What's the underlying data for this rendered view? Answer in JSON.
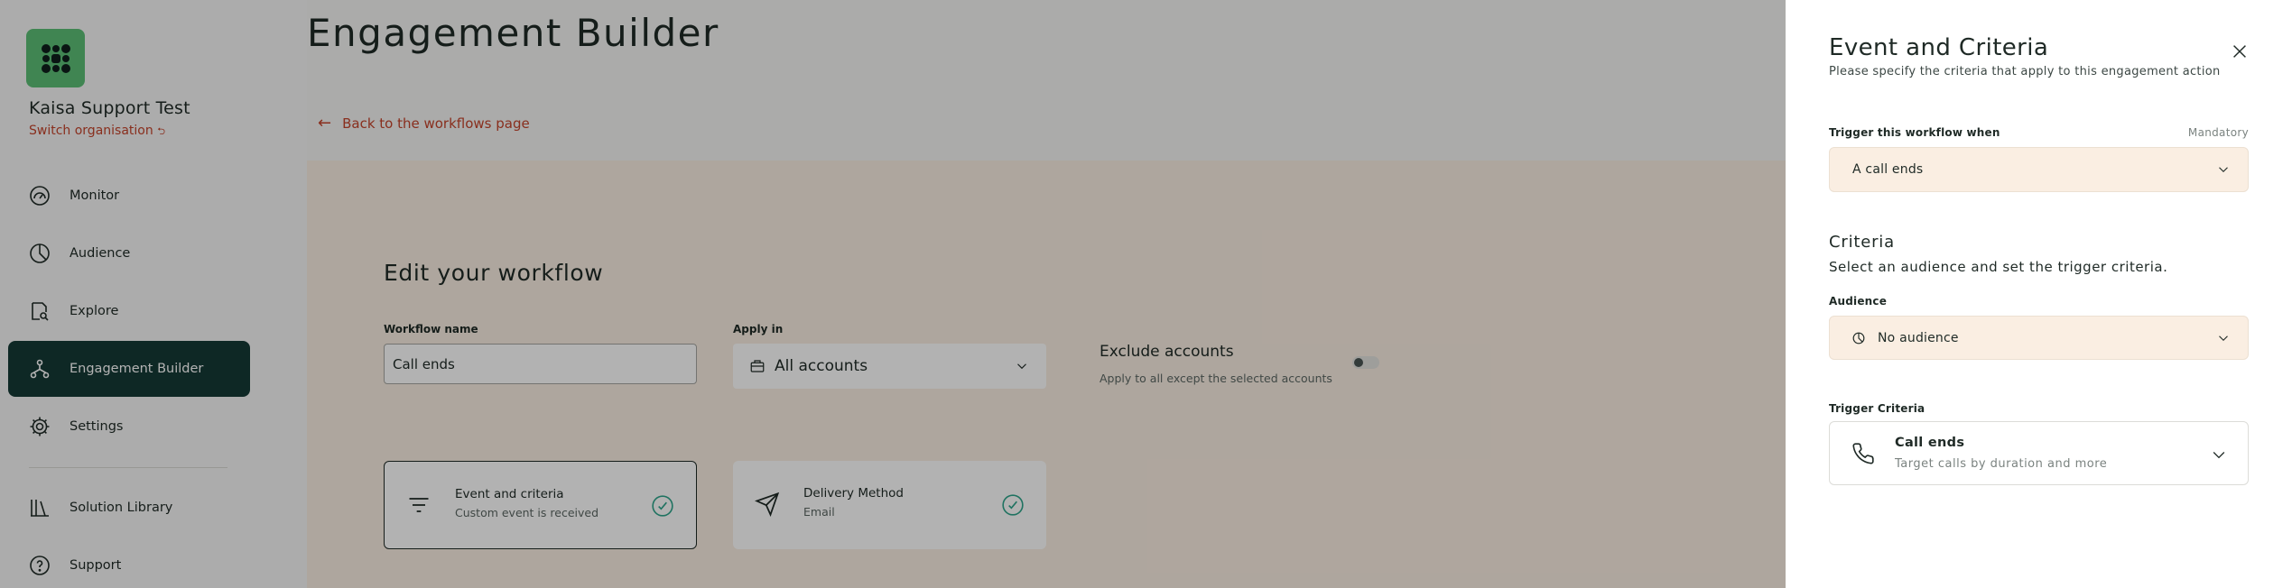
{
  "sidebar": {
    "org_name": "Kaisa Support Test",
    "switch_label": "Switch organisation",
    "switch_glyph": "⮌",
    "items": [
      {
        "label": "Monitor",
        "icon": "gauge-icon"
      },
      {
        "label": "Audience",
        "icon": "pie-chart-icon"
      },
      {
        "label": "Explore",
        "icon": "explore-icon"
      },
      {
        "label": "Engagement Builder",
        "icon": "workflow-icon",
        "active": true
      },
      {
        "label": "Settings",
        "icon": "gear-icon"
      },
      {
        "label": "Solution Library",
        "icon": "library-icon"
      },
      {
        "label": "Support",
        "icon": "help-icon"
      }
    ]
  },
  "main": {
    "title": "Engagement Builder",
    "back_label": "Back to the workflows page",
    "edit_title": "Edit your workflow",
    "workflow_name_label": "Workflow name",
    "workflow_name_value": "Call ends",
    "apply_in_label": "Apply in",
    "apply_in_value": "All accounts",
    "exclude_title": "Exclude accounts",
    "exclude_sub": "Apply to all except the selected accounts",
    "exclude_enabled": false,
    "cards": [
      {
        "title": "Event and criteria",
        "sub": "Custom event is received"
      },
      {
        "title": "Delivery Method",
        "sub": "Email"
      }
    ]
  },
  "drawer": {
    "title": "Event and Criteria",
    "subtitle": "Please specify the criteria that apply to this engagement action",
    "trigger_label": "Trigger this workflow when",
    "mandatory": "Mandatory",
    "trigger_value": "A call ends",
    "criteria_title": "Criteria",
    "criteria_sub": "Select an audience and set the trigger criteria.",
    "audience_label": "Audience",
    "audience_value": "No audience",
    "trigger_criteria_label": "Trigger Criteria",
    "trigger_criteria_title": "Call ends",
    "trigger_criteria_sub": "Target calls by duration and more"
  },
  "colors": {
    "accent_red": "#c4442c",
    "sidebar_active": "#153a36",
    "logo_green": "#5cbf76",
    "check_teal": "#2fa58c",
    "panel_bg": "#faeee2"
  }
}
